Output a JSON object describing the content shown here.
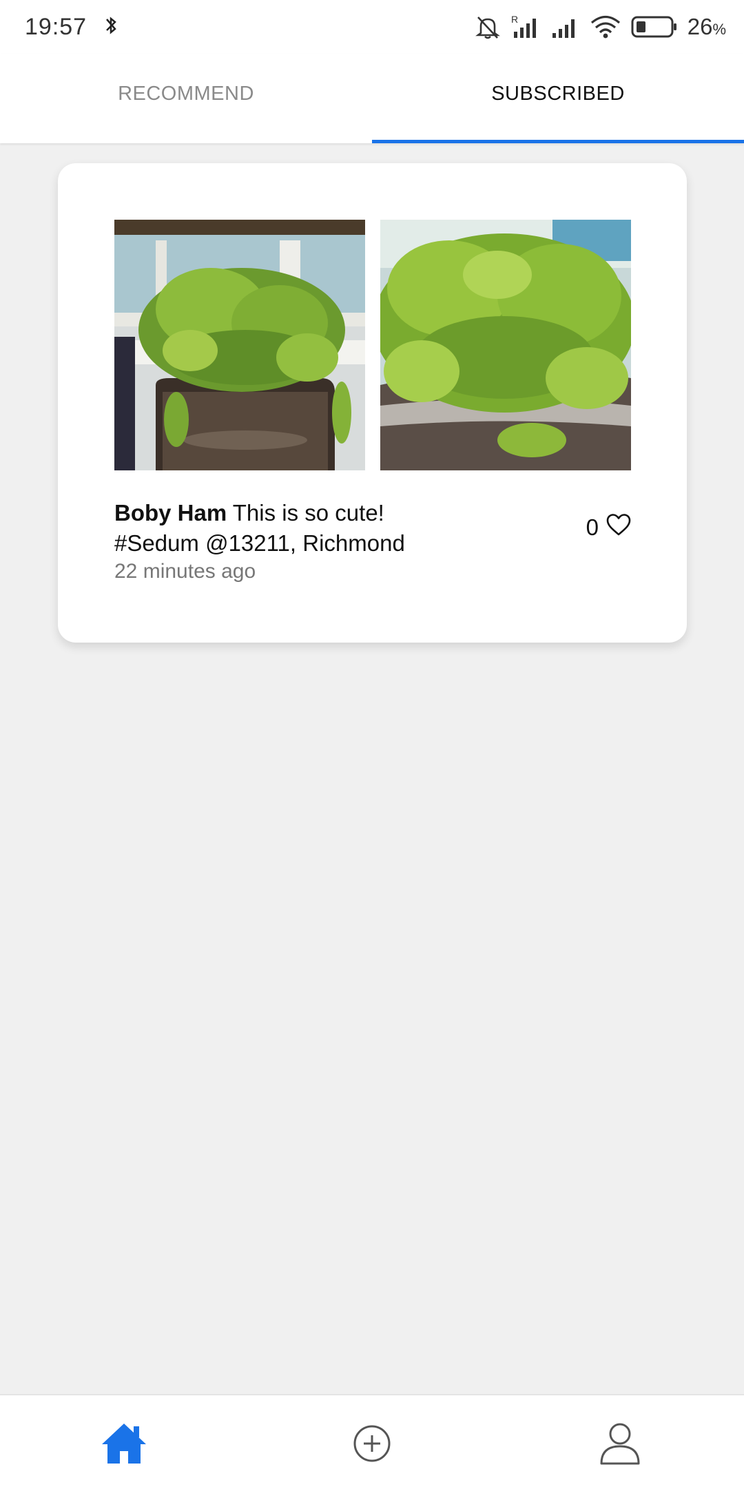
{
  "status_bar": {
    "time": "19:57",
    "battery_percent": "26",
    "battery_unit": "%",
    "icons": [
      "bluetooth-arrow-icon",
      "mute-icon",
      "signal-roaming-icon",
      "signal-icon",
      "wifi-icon",
      "battery-icon"
    ]
  },
  "tabs": [
    {
      "label": "RECOMMEND",
      "active": false
    },
    {
      "label": "SUBSCRIBED",
      "active": true
    }
  ],
  "accent_color": "#1a73e8",
  "post": {
    "images": [
      "sedum-plant-photo-1",
      "sedum-plant-photo-2"
    ],
    "author": "Boby Ham",
    "text": " This is so cute!",
    "tags_location": "#Sedum @13211, Richmond",
    "time_ago": "22 minutes ago",
    "like_count": "0"
  },
  "bottom_nav": {
    "items": [
      "home-icon",
      "add-post-icon",
      "profile-icon"
    ],
    "active": "home-icon"
  }
}
